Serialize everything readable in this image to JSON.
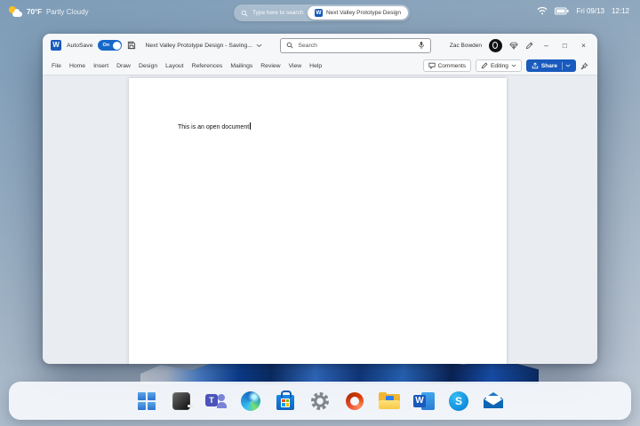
{
  "topbar": {
    "weather": {
      "temperature": "70°F",
      "condition": "Partly Cloudy"
    },
    "search_placeholder": "Type here to search",
    "running_app_label": "Next Valley Prototype Design",
    "date": "Fri 09/13",
    "time": "12:12"
  },
  "word_window": {
    "autosave_label": "AutoSave",
    "autosave_state": "On",
    "document_title": "Next Valley Prototype Design - Saving...",
    "search_placeholder": "Search",
    "user_name": "Zac Bowden",
    "ribbon_tabs": [
      "File",
      "Home",
      "Insert",
      "Draw",
      "Design",
      "Layout",
      "References",
      "Mailings",
      "Review",
      "View",
      "Help"
    ],
    "comments_label": "Comments",
    "editing_label": "Editing",
    "share_label": "Share",
    "document_text": "This is an open document",
    "controls": {
      "minimize": "–",
      "maximize": "□",
      "close": "×"
    }
  },
  "icons": {
    "word_letter": "W",
    "teams_letter": "T",
    "skype_letter": "S"
  },
  "taskbar": {
    "items": [
      "start",
      "terminal",
      "teams",
      "edge",
      "store",
      "settings",
      "office",
      "file-explorer",
      "word",
      "skype",
      "mail"
    ]
  },
  "colors": {
    "word_accent": "#185abd",
    "autosave_toggle": "#1668c7",
    "desktop_top": "#7d9cb7",
    "desktop_bottom": "#bfc9d5",
    "taskbar_bg": "#f4f8fc"
  }
}
